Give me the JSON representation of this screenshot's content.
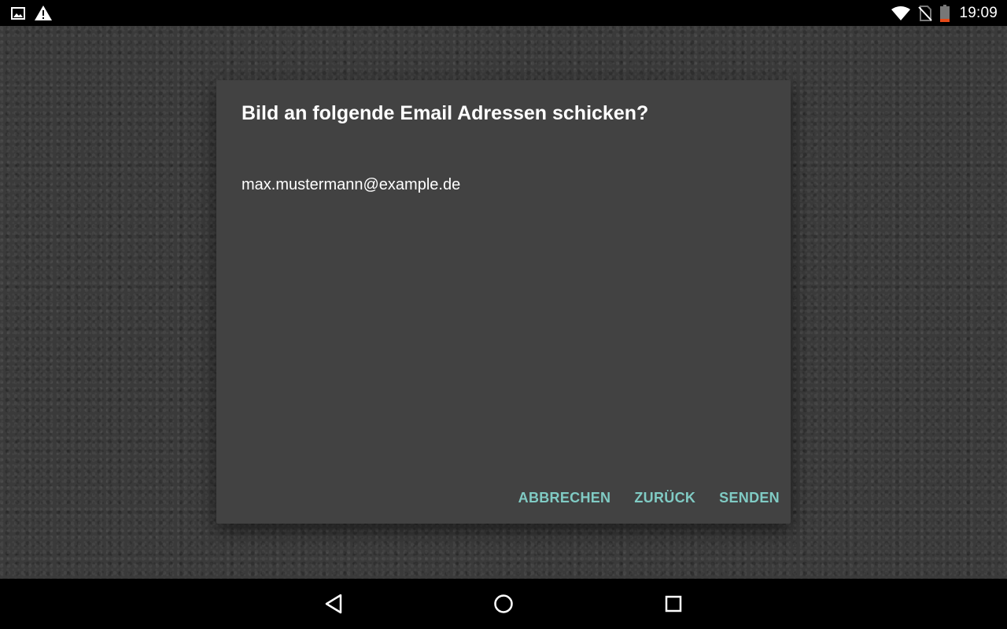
{
  "status_bar": {
    "time": "19:09",
    "icons_left": [
      "image-notification-icon",
      "warning-icon"
    ],
    "icons_right": [
      "wifi-icon",
      "no-sim-icon",
      "battery-low-icon"
    ]
  },
  "dialog": {
    "title": "Bild an folgende Email Adressen schicken?",
    "email": "max.mustermann@example.de",
    "buttons": {
      "cancel": "ABBRECHEN",
      "back": "ZURÜCK",
      "send": "SENDEN"
    }
  },
  "nav_bar": {
    "icons": [
      "back-icon",
      "home-icon",
      "recents-icon"
    ]
  },
  "colors": {
    "dialog_background": "#424242",
    "accent": "#80cbc4",
    "battery_low": "#e64a19"
  }
}
